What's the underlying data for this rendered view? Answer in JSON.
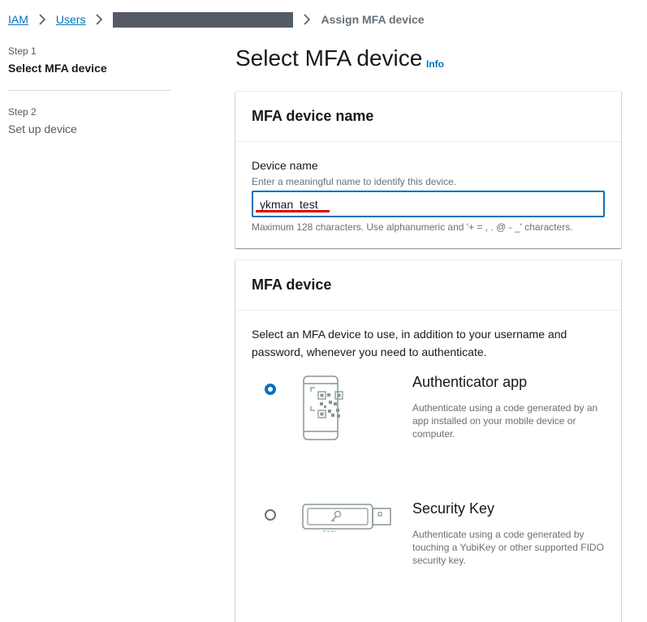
{
  "breadcrumb": {
    "items": [
      "IAM",
      "Users"
    ],
    "current": "Assign MFA device"
  },
  "steps": [
    {
      "number": "Step 1",
      "title": "Select MFA device"
    },
    {
      "number": "Step 2",
      "title": "Set up device"
    }
  ],
  "page": {
    "title": "Select MFA device",
    "info_label": "Info"
  },
  "device_name_panel": {
    "header": "MFA device name",
    "label": "Device name",
    "description": "Enter a meaningful name to identify this device.",
    "value": "ykman_test",
    "constraint": "Maximum 128 characters. Use alphanumeric and '+ = , . @ - _' characters."
  },
  "mfa_device_panel": {
    "header": "MFA device",
    "intro": "Select an MFA device to use, in addition to your username and password, whenever you need to authenticate.",
    "options": [
      {
        "title": "Authenticator app",
        "description": "Authenticate using a code generated by an app installed on your mobile device or computer.",
        "selected": true,
        "icon": "phone-qr-icon"
      },
      {
        "title": "Security Key",
        "description": "Authenticate using a code generated by touching a YubiKey or other supported FIDO security key.",
        "selected": false,
        "icon": "usb-security-key-icon"
      }
    ]
  },
  "colors": {
    "link": "#0073bb",
    "text": "#16191f",
    "muted": "#687078",
    "highlight": "#e00000"
  }
}
